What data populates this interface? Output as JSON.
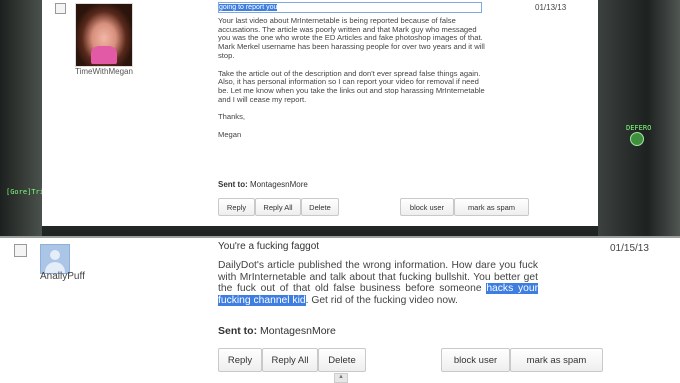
{
  "top_message": {
    "sender": "TimeWithMegan",
    "date": "01/13/13",
    "subject": "going to report you",
    "body": [
      "Your last video about MrInternetable is being reported because of false accusations. The article was poorly written and that Mark guy who messaged you was the one who wrote the ED Articles and fake photoshop images of that. Mark Merkel username has been harassing people for over two years and it will stop.",
      "Take the article out of the description and don't ever spread false things again. Also, it has personal information so I can report your video for removal if need be. Let me know when you take the links out and stop harassing MrInternetable and I will cease my report.",
      "Thanks,",
      "Megan"
    ],
    "sent_to_label": "Sent to:",
    "sent_to": "MontagesnMore",
    "buttons": {
      "reply": "Reply",
      "reply_all": "Reply All",
      "delete": "Delete",
      "block_user": "block user",
      "mark_as_spam": "mark as spam"
    }
  },
  "bottom_message": {
    "sender": "AnallyPuff",
    "date": "01/15/13",
    "subject": "You're a fucking faggot",
    "body_part1": "DailyDot's article published the wrong information. How dare you fuck with MrInternetable and talk about that fucking bullshit. You better get the fuck out of that old false business before someone ",
    "body_highlight": "hacks your fucking channel kid",
    "body_part2": ". Get rid of the fucking video now.",
    "sent_to_label": "Sent to:",
    "sent_to": "MontagesnMore",
    "buttons": {
      "reply": "Reply",
      "reply_all": "Reply All",
      "delete": "Delete",
      "block_user": "block user",
      "mark_as_spam": "mark as spam"
    }
  },
  "background": {
    "game_tag_left": "[Gore]Trix",
    "game_tag_right": "DEFERO"
  },
  "colors": {
    "highlight": "#3e7ee0",
    "panel": "#ffffff"
  }
}
